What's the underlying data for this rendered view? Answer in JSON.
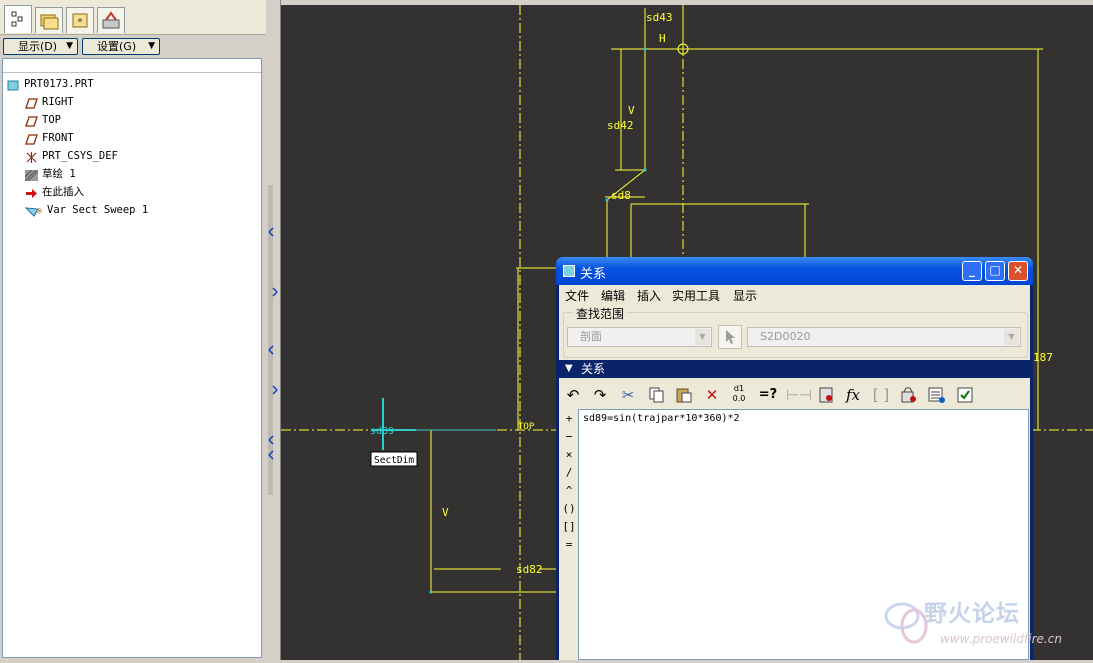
{
  "left_panel": {
    "display_menu": "显示(D)",
    "settings_menu": "设置(G)",
    "tree": [
      {
        "label": "PRT0173.PRT",
        "icon": "part-icon"
      },
      {
        "label": "RIGHT",
        "icon": "datum-plane-icon"
      },
      {
        "label": "TOP",
        "icon": "datum-plane-icon"
      },
      {
        "label": "FRONT",
        "icon": "datum-plane-icon"
      },
      {
        "label": "PRT_CSYS_DEF",
        "icon": "csys-icon"
      },
      {
        "label": "草绘 1",
        "icon": "sketch-icon"
      },
      {
        "label": "在此插入",
        "icon": "insert-here-arrow-icon"
      },
      {
        "label": "Var Sect Sweep 1",
        "icon": "var-sect-sweep-icon"
      }
    ]
  },
  "canvas": {
    "dims": {
      "d43": "sd43",
      "h": "H",
      "v_top": "V",
      "d42": "sd42",
      "d8": "sd8",
      "d87": "187",
      "d89": "sd89",
      "sectdim": "SectDim",
      "top": "TOP",
      "v_bottom": "V",
      "d82": "sd82"
    },
    "colors": {
      "background": "#333231",
      "sketch": "#ffff33",
      "section_dim": "#33cccc"
    }
  },
  "dialog": {
    "title": "关系",
    "menu": [
      "文件",
      "编辑",
      "插入",
      "实用工具",
      "显示"
    ],
    "search_scope_label": "查找范围",
    "scope_combo": "剖面",
    "object_combo": "S2D0020",
    "relations_header": "关系",
    "operators": [
      "+",
      "−",
      "×",
      "/",
      "^",
      "()",
      "[]",
      "="
    ],
    "relation_text": "sd89=sin(trajpar*10*360)*2"
  },
  "watermark": {
    "title": "野火论坛",
    "url": "www.proewildfire.cn"
  }
}
